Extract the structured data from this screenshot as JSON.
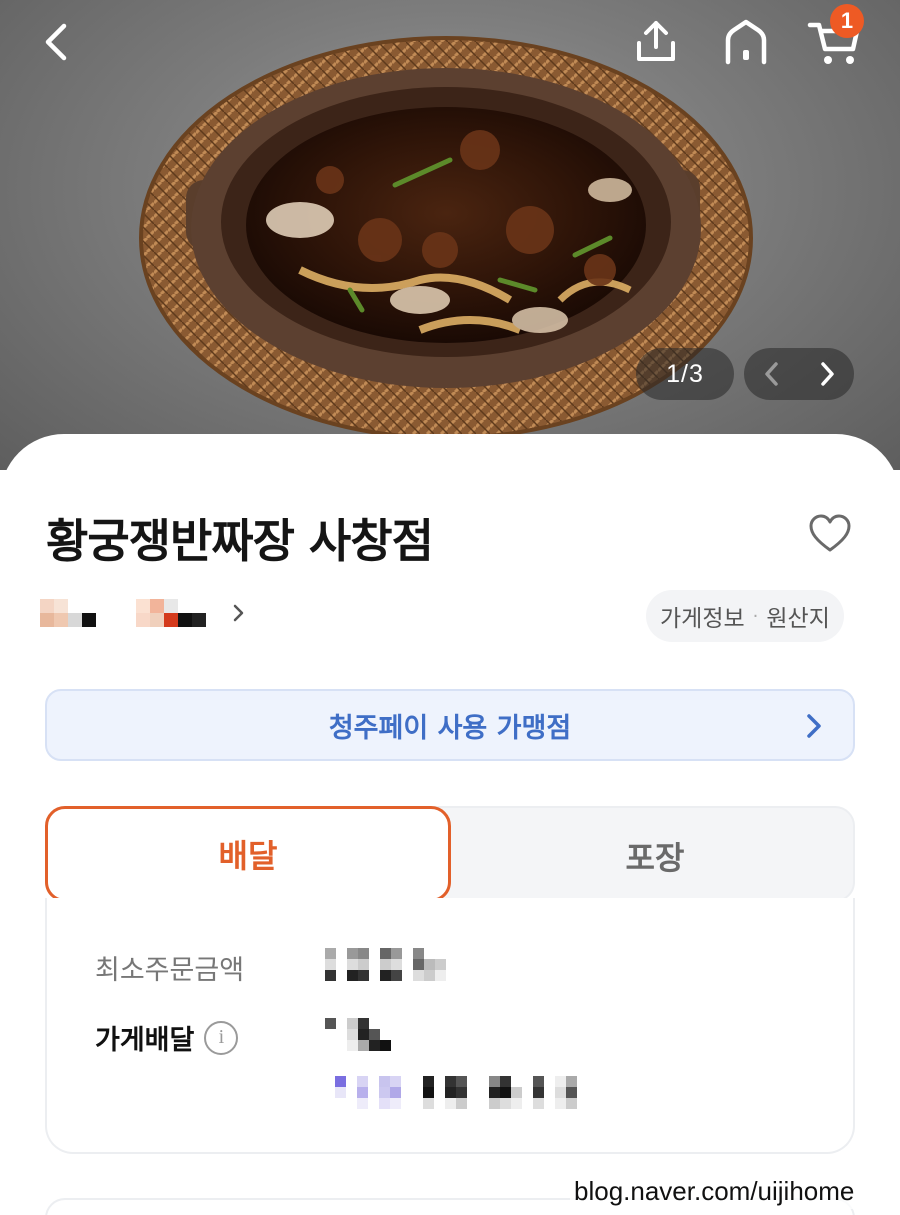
{
  "hero": {
    "image": "jjajang-noodles-in-clay-pot",
    "pager": {
      "current": "1",
      "separator": "/",
      "total": "3"
    },
    "cart_count": "1"
  },
  "store": {
    "name": "황궁쟁반짜장 사창점",
    "info_link": "가게정보",
    "info_dot": "·",
    "origin_link": "원산지"
  },
  "pay_banner": {
    "label": "청주페이 사용 가맹점"
  },
  "tabs": [
    {
      "label": "배달",
      "active": true
    },
    {
      "label": "포장",
      "active": false
    }
  ],
  "delivery_info": {
    "min_order_label": "최소주문금액",
    "delivery_label": "가게배달",
    "info_icon": "i"
  },
  "colors": {
    "accent": "#e2602a",
    "badge": "#ee5a24",
    "pay_blue": "#3f6ec6"
  },
  "watermark": "blog.naver.com/uijihome"
}
